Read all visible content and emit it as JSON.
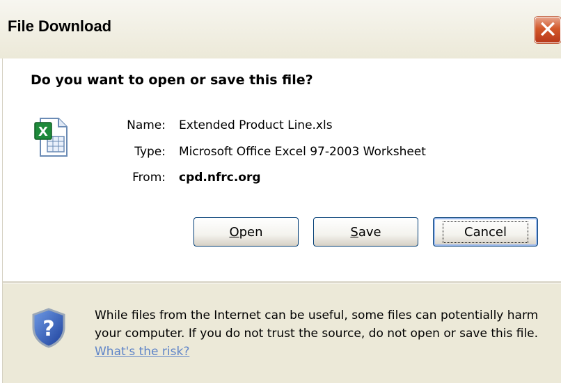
{
  "window": {
    "title": "File Download",
    "close_icon": "close-icon"
  },
  "main": {
    "question": "Do you want to open or save this file?",
    "file_icon": "excel-file-icon",
    "fields": [
      {
        "label": "Name:",
        "value": "Extended Product Line.xls"
      },
      {
        "label": "Type:",
        "value": "Microsoft Office Excel 97-2003 Worksheet"
      },
      {
        "label": "From:",
        "value": "cpd.nfrc.org"
      }
    ]
  },
  "buttons": {
    "open": {
      "accel": "O",
      "rest": "pen"
    },
    "save": {
      "accel": "S",
      "rest": "ave"
    },
    "cancel": "Cancel"
  },
  "warning": {
    "icon": "shield-question-icon",
    "text": "While files from the Internet can be useful, some files can potentially harm your computer. If you do not trust the source, do not open or save this file.",
    "link": "What's the risk?"
  },
  "colors": {
    "dialog_bg": "#ece9d8",
    "close_button": "#d2582a",
    "button_border": "#003c74",
    "link": "#5e84c8"
  }
}
